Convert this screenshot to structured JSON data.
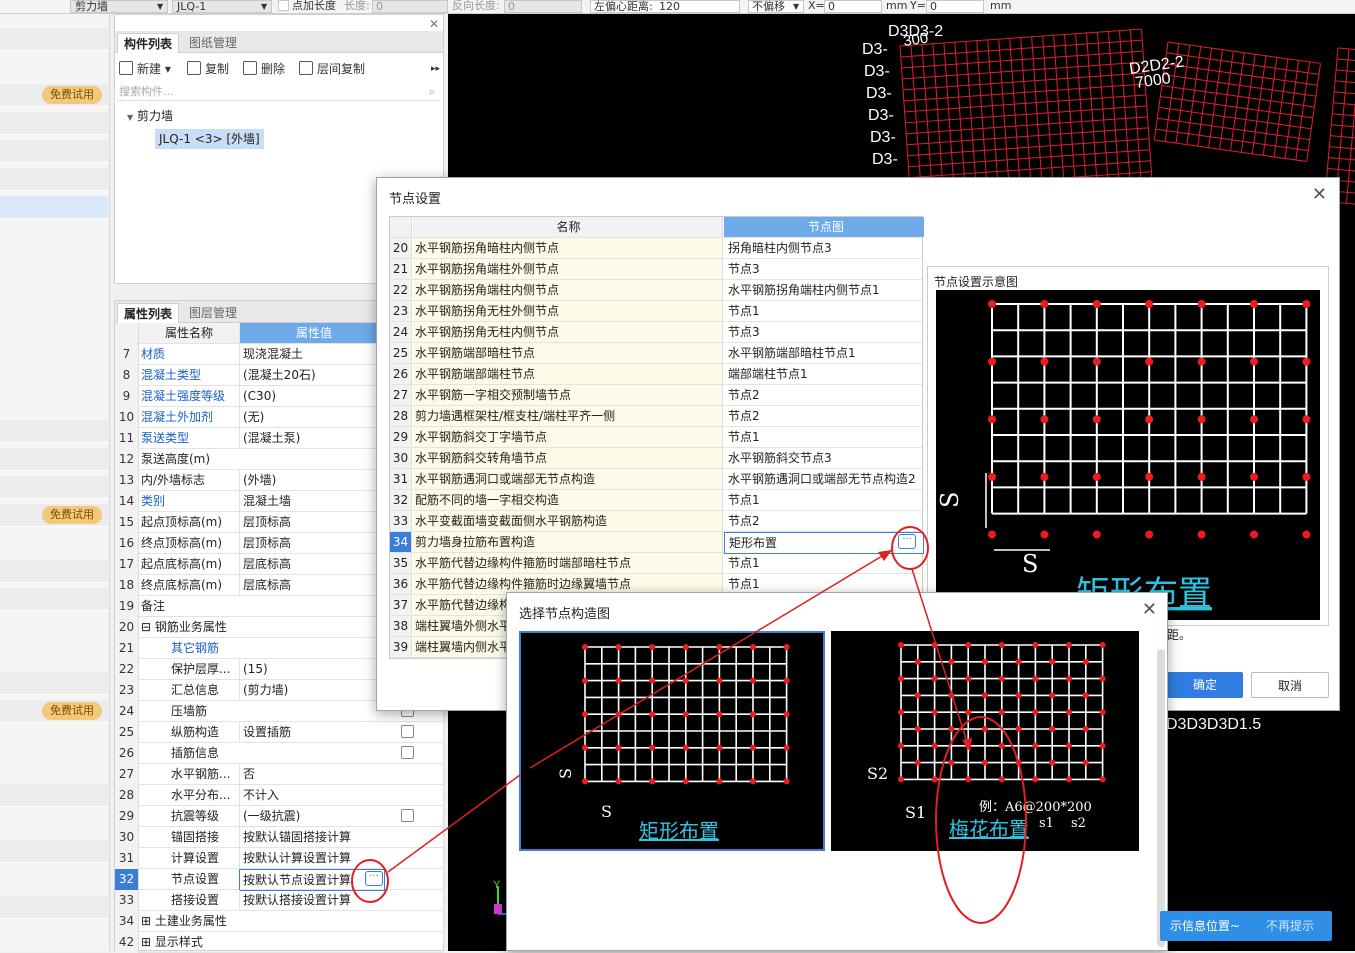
{
  "toolbar": {
    "combo1": "剪力墙",
    "combo2": "JLQ-1",
    "add_length_label": "点加长度",
    "length_label": "长度:",
    "length_value": "0",
    "reverse_length_label": "反向长度:",
    "reverse_length_value": "0",
    "left_offset_label": "左偏心距离:",
    "left_offset_value": "120",
    "offset_mode": "不偏移",
    "x_label": "X=",
    "x_value": "0",
    "mm1": "mm",
    "y_label": "Y=",
    "y_value": "0",
    "mm2": "mm"
  },
  "left_strip": {
    "badge": "免费试用"
  },
  "component_panel": {
    "tab_active": "构件列表",
    "tab_other": "图纸管理",
    "btn_new": "新建",
    "btn_copy": "复制",
    "btn_delete": "删除",
    "btn_floor_copy": "层间复制",
    "search_placeholder": "搜索构件...",
    "tree_root": "剪力墙",
    "tree_item": "JLQ-1 <3> [外墙]"
  },
  "props_panel": {
    "tab_active": "属性列表",
    "tab_other": "图层管理",
    "col_name": "属性名称",
    "col_value": "属性值",
    "rows": [
      {
        "n": "7",
        "name": "材质",
        "value": "现浇混凝土",
        "link": true
      },
      {
        "n": "8",
        "name": "混凝土类型",
        "value": "(混凝土20石)",
        "link": true
      },
      {
        "n": "9",
        "name": "混凝土强度等级",
        "value": "(C30)",
        "link": true
      },
      {
        "n": "10",
        "name": "混凝土外加剂",
        "value": "(无)",
        "link": true
      },
      {
        "n": "11",
        "name": "泵送类型",
        "value": "(混凝土泵)",
        "link": true
      },
      {
        "n": "12",
        "name": "泵送高度(m)",
        "value": ""
      },
      {
        "n": "13",
        "name": "内/外墙标志",
        "value": "(外墙)"
      },
      {
        "n": "14",
        "name": "类别",
        "value": "混凝土墙",
        "link": true
      },
      {
        "n": "15",
        "name": "起点顶标高(m)",
        "value": "层顶标高"
      },
      {
        "n": "16",
        "name": "终点顶标高(m)",
        "value": "层顶标高"
      },
      {
        "n": "17",
        "name": "起点底标高(m)",
        "value": "层底标高"
      },
      {
        "n": "18",
        "name": "终点底标高(m)",
        "value": "层底标高"
      },
      {
        "n": "19",
        "name": "备注",
        "value": ""
      },
      {
        "n": "20",
        "name": "⊟ 钢筋业务属性",
        "value": ""
      },
      {
        "n": "21",
        "name": "其它钢筋",
        "value": "",
        "link": true,
        "indent": true
      },
      {
        "n": "22",
        "name": "保护层厚...",
        "value": "(15)",
        "indent": true
      },
      {
        "n": "23",
        "name": "汇总信息",
        "value": "(剪力墙)",
        "indent": true
      },
      {
        "n": "24",
        "name": "压墙筋",
        "value": "",
        "indent": true,
        "chk": true
      },
      {
        "n": "25",
        "name": "纵筋构造",
        "value": "设置插筋",
        "indent": true,
        "chk": true
      },
      {
        "n": "26",
        "name": "插筋信息",
        "value": "",
        "indent": true,
        "chk": true
      },
      {
        "n": "27",
        "name": "水平钢筋...",
        "value": "否",
        "indent": true
      },
      {
        "n": "28",
        "name": "水平分布...",
        "value": "不计入",
        "indent": true
      },
      {
        "n": "29",
        "name": "抗震等级",
        "value": "(一级抗震)",
        "indent": true,
        "chk": true
      },
      {
        "n": "30",
        "name": "锚固搭接",
        "value": "按默认锚固搭接计算",
        "indent": true
      },
      {
        "n": "31",
        "name": "计算设置",
        "value": "按默认计算设置计算",
        "indent": true
      },
      {
        "n": "32",
        "name": "节点设置",
        "value": "按默认节点设置计算",
        "indent": true,
        "sel": true
      },
      {
        "n": "33",
        "name": "搭接设置",
        "value": "按默认搭接设置计算",
        "indent": true
      },
      {
        "n": "34",
        "name": "⊞ 土建业务属性",
        "value": ""
      },
      {
        "n": "42",
        "name": "⊞ 显示样式",
        "value": ""
      }
    ]
  },
  "cad": {
    "labels_left": [
      "D3-",
      "D3-",
      "D3-",
      "D3-",
      "D3-",
      "D3-"
    ],
    "label_top_a": "D3D3-2",
    "label_top_b": "300",
    "label_right_a": "D2D2-2",
    "label_right_b": "7000",
    "label_bottom": "D3D3D3D1.5",
    "axis_y": "Y"
  },
  "node_dialog": {
    "title": "节点设置",
    "col_name": "名称",
    "col_node": "节点图",
    "rows": [
      {
        "n": "20",
        "name": "水平钢筋拐角暗柱内侧节点",
        "node": "拐角暗柱内侧节点3"
      },
      {
        "n": "21",
        "name": "水平钢筋拐角端柱外侧节点",
        "node": "节点3"
      },
      {
        "n": "22",
        "name": "水平钢筋拐角端柱内侧节点",
        "node": "水平钢筋拐角端柱内侧节点1"
      },
      {
        "n": "23",
        "name": "水平钢筋拐角无柱外侧节点",
        "node": "节点1"
      },
      {
        "n": "24",
        "name": "水平钢筋拐角无柱内侧节点",
        "node": "节点3"
      },
      {
        "n": "25",
        "name": "水平钢筋端部暗柱节点",
        "node": "水平钢筋端部暗柱节点1"
      },
      {
        "n": "26",
        "name": "水平钢筋端部端柱节点",
        "node": "端部端柱节点1"
      },
      {
        "n": "27",
        "name": "水平钢筋一字相交预制墙节点",
        "node": "节点2"
      },
      {
        "n": "28",
        "name": "剪力墙遇框架柱/框支柱/端柱平齐一侧",
        "node": "节点2"
      },
      {
        "n": "29",
        "name": "水平钢筋斜交丁字墙节点",
        "node": "节点1"
      },
      {
        "n": "30",
        "name": "水平钢筋斜交转角墙节点",
        "node": "水平钢筋斜交节点3"
      },
      {
        "n": "31",
        "name": "水平钢筋遇洞口或端部无节点构造",
        "node": "水平钢筋遇洞口或端部无节点构造2"
      },
      {
        "n": "32",
        "name": "配筋不同的墙一字相交构造",
        "node": "节点1"
      },
      {
        "n": "33",
        "name": "水平变截面墙变截面侧水平钢筋构造",
        "node": "节点2"
      },
      {
        "n": "34",
        "name": "剪力墙身拉筋布置构造",
        "node": "矩形布置",
        "sel": true
      },
      {
        "n": "35",
        "name": "水平筋代替边缘构件箍筋时端部暗柱节点",
        "node": "节点1"
      },
      {
        "n": "36",
        "name": "水平筋代替边缘构件箍筋时边缘翼墙节点",
        "node": "节点1"
      },
      {
        "n": "37",
        "name": "水平筋代替边缘构",
        "node": ""
      },
      {
        "n": "38",
        "name": "端柱翼墙外侧水平",
        "node": ""
      },
      {
        "n": "39",
        "name": "端柱翼墙内侧水平",
        "node": ""
      }
    ],
    "preview_title": "节点设置示意图",
    "preview_caption": "矩形布置",
    "preview_s": "S",
    "preview_note_tail": "距。",
    "ok_label": "确定",
    "cancel_label": "取消"
  },
  "select_dialog": {
    "title": "选择节点构造图",
    "option1": {
      "caption": "矩形布置",
      "s_label": "S"
    },
    "option2": {
      "caption": "梅花布置",
      "s1_label": "S1",
      "s2_label": "S2",
      "example": "例：A6@200*200",
      "ex_s1": "s1",
      "ex_s2": "s2"
    }
  },
  "notification": {
    "text": "示信息位置~",
    "dismiss": "不再提示"
  },
  "colors": {
    "accent": "#3b7ed8",
    "header_blue": "#6ea9ea",
    "cad_grid": "#e0202a",
    "link_cyan": "#2fc4e0",
    "annotation_red": "#e02020"
  }
}
